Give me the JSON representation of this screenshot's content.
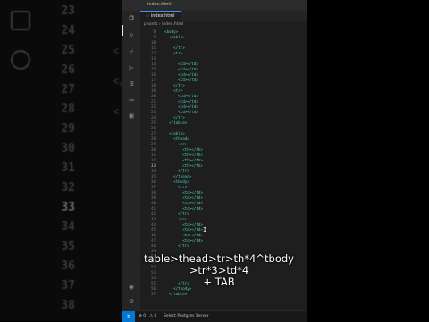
{
  "background": {
    "line_numbers": [
      "23",
      "24",
      "25",
      "26",
      "27",
      "28",
      "29",
      "30",
      "31",
      "32",
      "33",
      "34",
      "35",
      "36",
      "37",
      "38"
    ],
    "active_line": "33",
    "tags": [
      "<",
      "</",
      "<"
    ]
  },
  "window": {
    "title": "index.html"
  },
  "tab": {
    "label": "index.html"
  },
  "breadcrumb": {
    "folder": "phonts",
    "sep": "›",
    "file": "index.html"
  },
  "code_lines": [
    {
      "n": "8",
      "t": "  <body>",
      "indent": 0
    },
    {
      "n": "9",
      "t": "    <table>",
      "indent": 1
    },
    {
      "n": "10",
      "t": "",
      "indent": 2
    },
    {
      "n": "11",
      "t": "      </tr>",
      "indent": 2
    },
    {
      "n": "12",
      "t": "      <tr>",
      "indent": 2
    },
    {
      "n": "13",
      "t": "",
      "indent": 2
    },
    {
      "n": "14",
      "t": "        <td></td>",
      "indent": 3
    },
    {
      "n": "15",
      "t": "        <td></td>",
      "indent": 3
    },
    {
      "n": "16",
      "t": "        <td></td>",
      "indent": 3
    },
    {
      "n": "17",
      "t": "        <td></td>",
      "indent": 3
    },
    {
      "n": "18",
      "t": "      </tr>",
      "indent": 2
    },
    {
      "n": "19",
      "t": "      <tr>",
      "indent": 2
    },
    {
      "n": "20",
      "t": "        <td></td>",
      "indent": 3
    },
    {
      "n": "21",
      "t": "        <td></td>",
      "indent": 3
    },
    {
      "n": "22",
      "t": "        <td></td>",
      "indent": 3
    },
    {
      "n": "23",
      "t": "        <td></td>",
      "indent": 3
    },
    {
      "n": "24",
      "t": "      </tr>",
      "indent": 2
    },
    {
      "n": "25",
      "t": "    </table>",
      "indent": 1
    },
    {
      "n": "26",
      "t": "",
      "indent": 1
    },
    {
      "n": "27",
      "t": "    <table>",
      "indent": 1
    },
    {
      "n": "28",
      "t": "      <thead>",
      "indent": 2
    },
    {
      "n": "29",
      "t": "        <tr>",
      "indent": 3
    },
    {
      "n": "30",
      "t": "          <th></th>",
      "indent": 4
    },
    {
      "n": "31",
      "t": "          <th></th>",
      "indent": 4
    },
    {
      "n": "32",
      "t": "          <th></th>",
      "indent": 4
    },
    {
      "n": "33",
      "t": "          <th></th>",
      "indent": 4
    },
    {
      "n": "34",
      "t": "        </tr>",
      "indent": 3
    },
    {
      "n": "35",
      "t": "      </thead>",
      "indent": 2
    },
    {
      "n": "36",
      "t": "      <tbody>",
      "indent": 2
    },
    {
      "n": "37",
      "t": "        <tr>",
      "indent": 3
    },
    {
      "n": "38",
      "t": "          <td></td>",
      "indent": 4
    },
    {
      "n": "39",
      "t": "          <td></td>",
      "indent": 4
    },
    {
      "n": "40",
      "t": "          <td></td>",
      "indent": 4
    },
    {
      "n": "41",
      "t": "          <td></td>",
      "indent": 4
    },
    {
      "n": "42",
      "t": "        </tr>",
      "indent": 3
    },
    {
      "n": "43",
      "t": "        <tr>",
      "indent": 3
    },
    {
      "n": "44",
      "t": "          <td></td>",
      "indent": 4
    },
    {
      "n": "45",
      "t": "          <td></td>",
      "indent": 4
    },
    {
      "n": "46",
      "t": "          <td></td>",
      "indent": 4
    },
    {
      "n": "47",
      "t": "          <td></td>",
      "indent": 4
    },
    {
      "n": "48",
      "t": "        </tr>",
      "indent": 3
    },
    {
      "n": "49",
      "t": "",
      "indent": 3
    },
    {
      "n": "50",
      "t": "",
      "indent": 3
    },
    {
      "n": "51",
      "t": "",
      "indent": 3
    },
    {
      "n": "52",
      "t": "",
      "indent": 3
    },
    {
      "n": "53",
      "t": "",
      "indent": 3
    },
    {
      "n": "54",
      "t": "",
      "indent": 3
    },
    {
      "n": "55",
      "t": "        </tr>",
      "indent": 3
    },
    {
      "n": "56",
      "t": "      </tbody>",
      "indent": 2
    },
    {
      "n": "57",
      "t": "    </table>",
      "indent": 1
    }
  ],
  "current_line": "33",
  "statusbar": {
    "errors": "⊗ 0",
    "warnings": "⚠ 0",
    "postgres": "Select Postgres Server"
  },
  "caption": {
    "line1": "table>thead>tr>th*4^tbody",
    "line2": ">tr*3>td*4",
    "line3": "+ TAB"
  },
  "colors": {
    "accent": "#0078d4",
    "tag": "#4ec9b0",
    "editor_bg": "#1e1e1e"
  }
}
